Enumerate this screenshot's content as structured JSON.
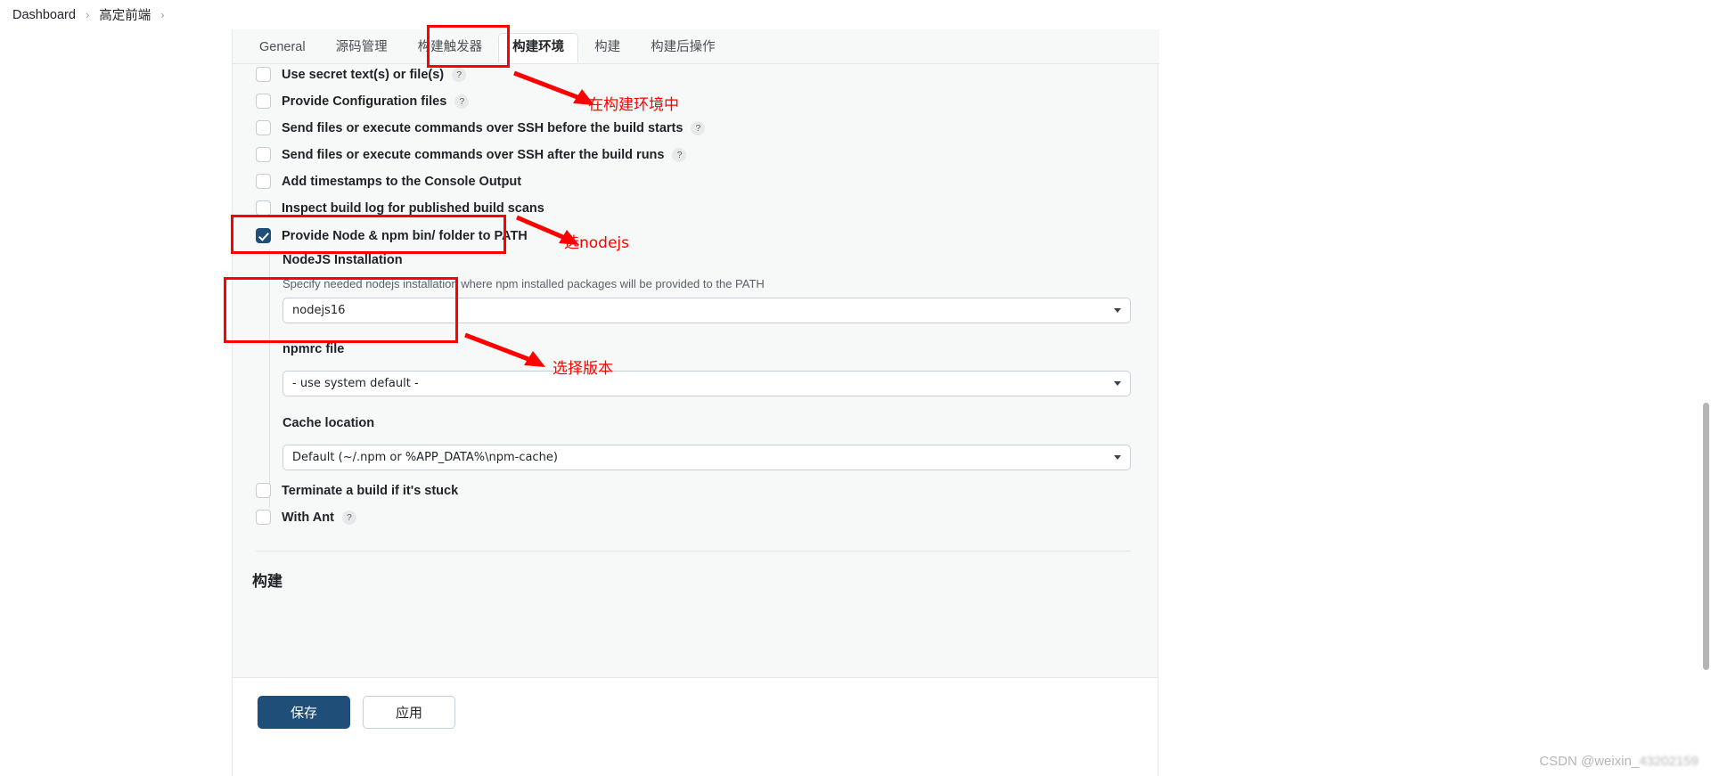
{
  "breadcrumb": {
    "items": [
      {
        "label": "Dashboard"
      },
      {
        "label": "高定前端"
      }
    ],
    "separator": "›"
  },
  "tabs": [
    {
      "label": "General",
      "active": false
    },
    {
      "label": "源码管理",
      "active": false
    },
    {
      "label": "构建触发器",
      "active": false
    },
    {
      "label": "构建环境",
      "active": true
    },
    {
      "label": "构建",
      "active": false
    },
    {
      "label": "构建后操作",
      "active": false
    }
  ],
  "checkboxes": [
    {
      "label": "Use secret text(s) or file(s)",
      "checked": false,
      "help": "?"
    },
    {
      "label": "Provide Configuration files",
      "checked": false,
      "help": "?"
    },
    {
      "label": "Send files or execute commands over SSH before the build starts",
      "checked": false,
      "help": "?"
    },
    {
      "label": "Send files or execute commands over SSH after the build runs",
      "checked": false,
      "help": "?"
    },
    {
      "label": "Add timestamps to the Console Output",
      "checked": false,
      "help": ""
    },
    {
      "label": "Inspect build log for published build scans",
      "checked": false,
      "help": ""
    },
    {
      "label": "Provide Node & npm bin/ folder to PATH",
      "checked": true,
      "help": ""
    }
  ],
  "nodejs_section": {
    "installation_label": "NodeJS Installation",
    "installation_hint": "Specify needed nodejs installation where npm installed packages will be provided to the PATH",
    "installation_value": "nodejs16",
    "npmrc_label": "npmrc file",
    "npmrc_value": "- use system default -",
    "cache_label": "Cache location",
    "cache_value": "Default (~/.npm or %APP_DATA%\\npm-cache)"
  },
  "trailing_checkboxes": [
    {
      "label": "Terminate a build if it's stuck",
      "checked": false,
      "help": ""
    },
    {
      "label": "With Ant",
      "checked": false,
      "help": "?"
    }
  ],
  "build_section_title": "构建",
  "buttons": {
    "save": "保存",
    "apply": "应用"
  },
  "annotations": [
    {
      "text": "在构建环境中"
    },
    {
      "text": "选nodejs"
    },
    {
      "text": "选择版本"
    }
  ],
  "watermark": {
    "prefix": "CSDN @weixin_",
    "id": "43202159"
  },
  "colors": {
    "accent": "#1f4e79",
    "annotation": "#ff0000",
    "panel_bg": "#f7f8f8"
  }
}
